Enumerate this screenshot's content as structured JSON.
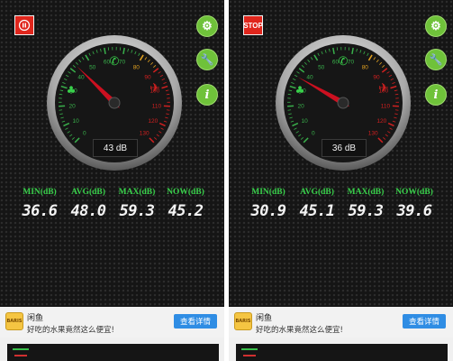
{
  "panels": [
    {
      "top_button": {
        "label": "",
        "icon": "pause-icon"
      },
      "side_buttons": [
        {
          "icon": "gear-icon"
        },
        {
          "icon": "wrench-icon"
        },
        {
          "icon": "info-icon",
          "label": "i"
        }
      ],
      "gauge": {
        "value_db": 43,
        "readout": "43 dB",
        "scale_labels": [
          "0",
          "10",
          "20",
          "30",
          "40",
          "50",
          "60",
          "70",
          "80",
          "90",
          "100",
          "110",
          "120",
          "130"
        ]
      },
      "stats": [
        {
          "label": "MIN(dB)",
          "value": "36.6"
        },
        {
          "label": "AVG(dB)",
          "value": "48.0"
        },
        {
          "label": "MAX(dB)",
          "value": "59.3"
        },
        {
          "label": "NOW(dB)",
          "value": "45.2"
        }
      ],
      "ad": {
        "title": "闲鱼",
        "subtitle": "好吃的水果竟然这么便宜!",
        "button": "查看详情",
        "icon_text": "BARIS"
      }
    },
    {
      "top_button": {
        "label": "STOP",
        "icon": "stop-icon"
      },
      "side_buttons": [
        {
          "icon": "gear-icon"
        },
        {
          "icon": "wrench-icon"
        },
        {
          "icon": "info-icon",
          "label": "i"
        }
      ],
      "gauge": {
        "value_db": 36,
        "readout": "36 dB",
        "scale_labels": [
          "0",
          "10",
          "20",
          "30",
          "40",
          "50",
          "60",
          "70",
          "80",
          "90",
          "100",
          "110",
          "120",
          "130"
        ]
      },
      "stats": [
        {
          "label": "MIN(dB)",
          "value": "30.9"
        },
        {
          "label": "AVG(dB)",
          "value": "45.1"
        },
        {
          "label": "MAX(dB)",
          "value": "59.3"
        },
        {
          "label": "NOW(dB)",
          "value": "39.6"
        }
      ],
      "ad": {
        "title": "闲鱼",
        "subtitle": "好吃的水果竟然这么便宜!",
        "button": "查看详情",
        "icon_text": "BARIS"
      }
    }
  ],
  "colors": {
    "accent_green": "#39d04b",
    "stop_red": "#e0261c",
    "ad_button_blue": "#2f8de4",
    "needle_red": "#cc1020"
  }
}
